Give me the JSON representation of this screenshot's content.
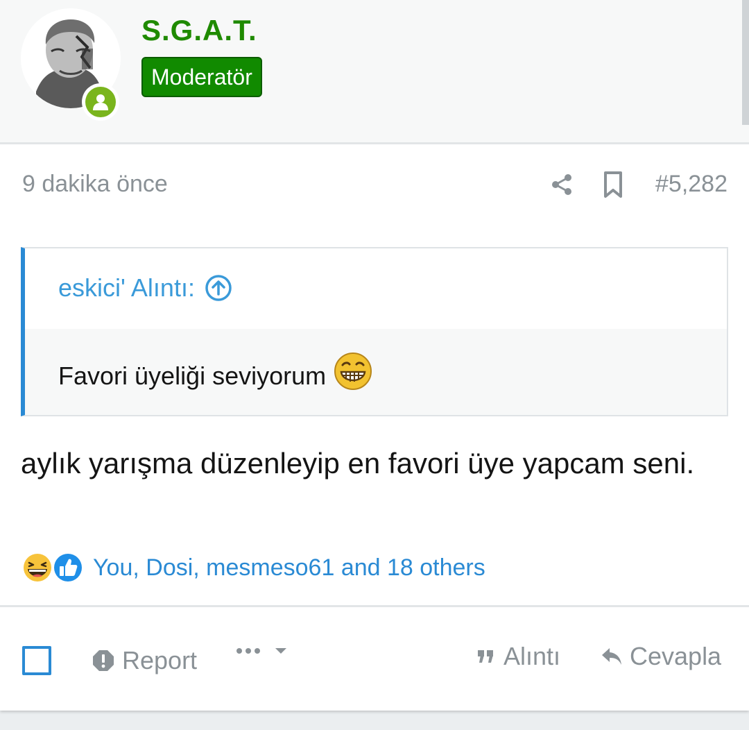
{
  "user": {
    "name": "S.G.A.T.",
    "role": "Moderatör",
    "status": "online"
  },
  "post": {
    "timestamp": "9 dakika önce",
    "number": "#5,282"
  },
  "quote": {
    "author": "eskici' Alıntı:",
    "text": "Favori üyeliği seviyorum"
  },
  "message": "aylık yarışma düzenleyip en favori üye yapcam seni.",
  "reactions": {
    "icons": [
      "haha-emoji-icon",
      "like-thumb-icon"
    ],
    "users": "You, Dosi, mesmeso61 and 18 others"
  },
  "actions": {
    "report": "Report",
    "quote": "Alıntı",
    "reply": "Cevapla"
  },
  "colors": {
    "accent": "#2a8ad4",
    "username": "#1f8a00",
    "role_badge": "#118a00",
    "online": "#7ab51d",
    "muted": "#8a9196"
  }
}
